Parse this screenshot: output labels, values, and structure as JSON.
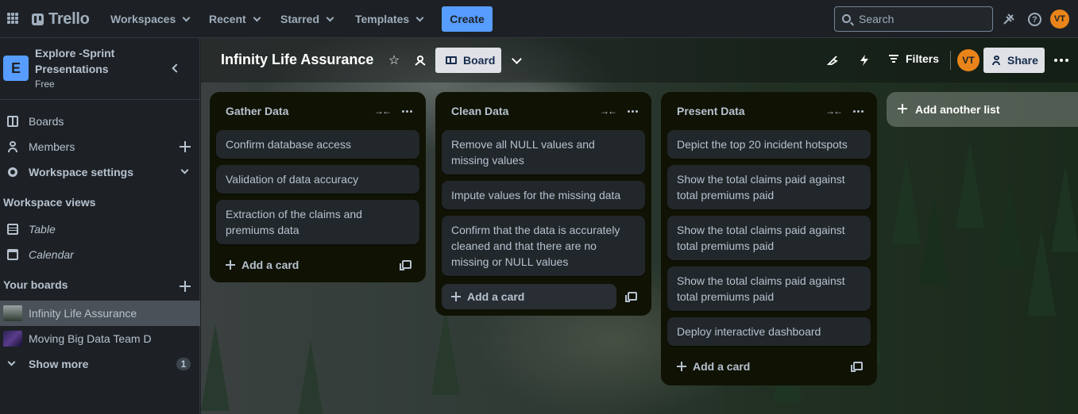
{
  "topnav": {
    "logo_text": "Trello",
    "menus": [
      "Workspaces",
      "Recent",
      "Starred",
      "Templates"
    ],
    "create_label": "Create",
    "search_placeholder": "Search",
    "avatar_initials": "VT",
    "avatar_color": "#e8841a"
  },
  "sidebar": {
    "workspace_initial": "E",
    "workspace_name": "Explore -Sprint Presentations",
    "workspace_plan": "Free",
    "nav": [
      "Boards",
      "Members",
      "Workspace settings"
    ],
    "views_title": "Workspace views",
    "views": [
      "Table",
      "Calendar"
    ],
    "your_boards_title": "Your boards",
    "boards": [
      "Infinity Life Assurance",
      "Moving Big Data Team D"
    ],
    "show_more_label": "Show more",
    "show_more_count": "1"
  },
  "board": {
    "title": "Infinity Life Assurance",
    "view_label": "Board",
    "filters_label": "Filters",
    "avatar_initials": "VT",
    "share_label": "Share",
    "add_list_label": "Add another list",
    "add_card_label": "Add a card",
    "lists": [
      {
        "title": "Gather Data",
        "cards": [
          "Confirm database access",
          "Validation of data accuracy",
          "Extraction of the claims and premiums data"
        ]
      },
      {
        "title": "Clean Data",
        "cards": [
          "Remove all NULL values and missing values",
          "Impute values for the missing data",
          "Confirm that the data is accurately cleaned and that there are no missing or NULL values"
        ]
      },
      {
        "title": "Present Data",
        "cards": [
          "Depict the top 20 incident hotspots",
          "Show the total claims paid against total premiums paid",
          "Show the total claims paid against total premiums paid",
          "Show the total claims paid against total premiums paid",
          "Deploy interactive dashboard"
        ]
      }
    ]
  }
}
